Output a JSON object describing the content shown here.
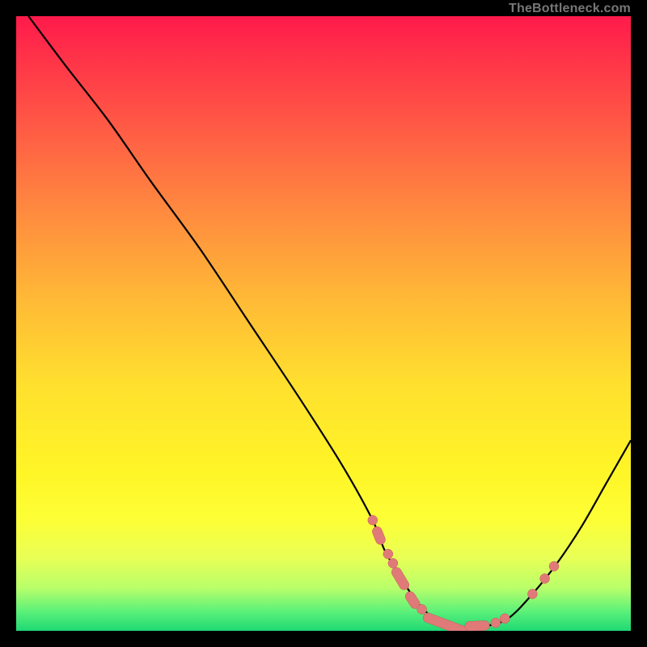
{
  "watermark": "TheBottleneck.com",
  "colors": {
    "line": "#000000",
    "marker": "#e07a78",
    "marker_stroke": "#c65c5a"
  },
  "chart_data": {
    "type": "line",
    "title": "",
    "xlabel": "",
    "ylabel": "",
    "xlim": [
      0,
      100
    ],
    "ylim": [
      0,
      100
    ],
    "grid": false,
    "legend": false,
    "series": [
      {
        "name": "curve",
        "x": [
          2,
          8,
          15,
          22,
          30,
          38,
          46,
          53,
          58,
          60,
          63,
          65,
          68,
          72,
          76,
          80,
          84,
          88,
          92,
          96,
          100
        ],
        "y": [
          100,
          92,
          83,
          73,
          62,
          50,
          38,
          27,
          18,
          13,
          8,
          5,
          2,
          0.5,
          0.7,
          2,
          6,
          11,
          17,
          24,
          31
        ]
      }
    ],
    "markers": [
      {
        "kind": "dot",
        "x": 58.0,
        "y": 18.0
      },
      {
        "kind": "pill",
        "x": 59.0,
        "y": 15.5,
        "len": 3
      },
      {
        "kind": "dot",
        "x": 60.5,
        "y": 12.5
      },
      {
        "kind": "dot",
        "x": 61.3,
        "y": 11.0
      },
      {
        "kind": "pill",
        "x": 62.5,
        "y": 8.5,
        "len": 4
      },
      {
        "kind": "pill",
        "x": 64.5,
        "y": 5.0,
        "len": 3
      },
      {
        "kind": "dot",
        "x": 66.0,
        "y": 3.5
      },
      {
        "kind": "pill",
        "x": 70.0,
        "y": 1.0,
        "len": 8
      },
      {
        "kind": "pill",
        "x": 75.0,
        "y": 0.8,
        "len": 4
      },
      {
        "kind": "dot",
        "x": 78.0,
        "y": 1.3
      },
      {
        "kind": "dot",
        "x": 79.5,
        "y": 2.0
      },
      {
        "kind": "dot",
        "x": 84.0,
        "y": 6.0
      },
      {
        "kind": "dot",
        "x": 86.0,
        "y": 8.5
      },
      {
        "kind": "dot",
        "x": 87.5,
        "y": 10.5
      }
    ]
  }
}
